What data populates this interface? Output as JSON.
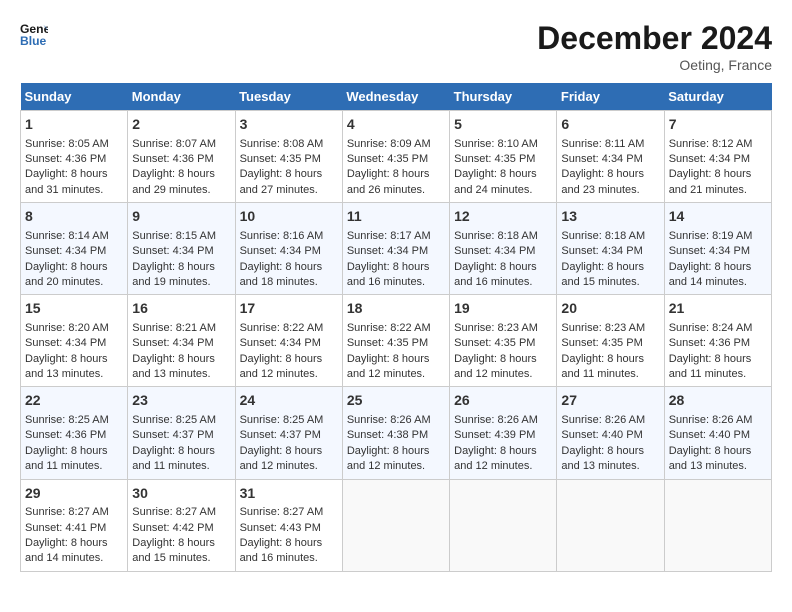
{
  "header": {
    "logo_line1": "General",
    "logo_line2": "Blue",
    "month": "December 2024",
    "location": "Oeting, France"
  },
  "weekdays": [
    "Sunday",
    "Monday",
    "Tuesday",
    "Wednesday",
    "Thursday",
    "Friday",
    "Saturday"
  ],
  "weeks": [
    [
      {
        "day": "1",
        "sunrise": "8:05 AM",
        "sunset": "4:36 PM",
        "daylight": "8 hours and 31 minutes."
      },
      {
        "day": "2",
        "sunrise": "8:07 AM",
        "sunset": "4:36 PM",
        "daylight": "8 hours and 29 minutes."
      },
      {
        "day": "3",
        "sunrise": "8:08 AM",
        "sunset": "4:35 PM",
        "daylight": "8 hours and 27 minutes."
      },
      {
        "day": "4",
        "sunrise": "8:09 AM",
        "sunset": "4:35 PM",
        "daylight": "8 hours and 26 minutes."
      },
      {
        "day": "5",
        "sunrise": "8:10 AM",
        "sunset": "4:35 PM",
        "daylight": "8 hours and 24 minutes."
      },
      {
        "day": "6",
        "sunrise": "8:11 AM",
        "sunset": "4:34 PM",
        "daylight": "8 hours and 23 minutes."
      },
      {
        "day": "7",
        "sunrise": "8:12 AM",
        "sunset": "4:34 PM",
        "daylight": "8 hours and 21 minutes."
      }
    ],
    [
      {
        "day": "8",
        "sunrise": "8:14 AM",
        "sunset": "4:34 PM",
        "daylight": "8 hours and 20 minutes."
      },
      {
        "day": "9",
        "sunrise": "8:15 AM",
        "sunset": "4:34 PM",
        "daylight": "8 hours and 19 minutes."
      },
      {
        "day": "10",
        "sunrise": "8:16 AM",
        "sunset": "4:34 PM",
        "daylight": "8 hours and 18 minutes."
      },
      {
        "day": "11",
        "sunrise": "8:17 AM",
        "sunset": "4:34 PM",
        "daylight": "8 hours and 16 minutes."
      },
      {
        "day": "12",
        "sunrise": "8:18 AM",
        "sunset": "4:34 PM",
        "daylight": "8 hours and 16 minutes."
      },
      {
        "day": "13",
        "sunrise": "8:18 AM",
        "sunset": "4:34 PM",
        "daylight": "8 hours and 15 minutes."
      },
      {
        "day": "14",
        "sunrise": "8:19 AM",
        "sunset": "4:34 PM",
        "daylight": "8 hours and 14 minutes."
      }
    ],
    [
      {
        "day": "15",
        "sunrise": "8:20 AM",
        "sunset": "4:34 PM",
        "daylight": "8 hours and 13 minutes."
      },
      {
        "day": "16",
        "sunrise": "8:21 AM",
        "sunset": "4:34 PM",
        "daylight": "8 hours and 13 minutes."
      },
      {
        "day": "17",
        "sunrise": "8:22 AM",
        "sunset": "4:34 PM",
        "daylight": "8 hours and 12 minutes."
      },
      {
        "day": "18",
        "sunrise": "8:22 AM",
        "sunset": "4:35 PM",
        "daylight": "8 hours and 12 minutes."
      },
      {
        "day": "19",
        "sunrise": "8:23 AM",
        "sunset": "4:35 PM",
        "daylight": "8 hours and 12 minutes."
      },
      {
        "day": "20",
        "sunrise": "8:23 AM",
        "sunset": "4:35 PM",
        "daylight": "8 hours and 11 minutes."
      },
      {
        "day": "21",
        "sunrise": "8:24 AM",
        "sunset": "4:36 PM",
        "daylight": "8 hours and 11 minutes."
      }
    ],
    [
      {
        "day": "22",
        "sunrise": "8:25 AM",
        "sunset": "4:36 PM",
        "daylight": "8 hours and 11 minutes."
      },
      {
        "day": "23",
        "sunrise": "8:25 AM",
        "sunset": "4:37 PM",
        "daylight": "8 hours and 11 minutes."
      },
      {
        "day": "24",
        "sunrise": "8:25 AM",
        "sunset": "4:37 PM",
        "daylight": "8 hours and 12 minutes."
      },
      {
        "day": "25",
        "sunrise": "8:26 AM",
        "sunset": "4:38 PM",
        "daylight": "8 hours and 12 minutes."
      },
      {
        "day": "26",
        "sunrise": "8:26 AM",
        "sunset": "4:39 PM",
        "daylight": "8 hours and 12 minutes."
      },
      {
        "day": "27",
        "sunrise": "8:26 AM",
        "sunset": "4:40 PM",
        "daylight": "8 hours and 13 minutes."
      },
      {
        "day": "28",
        "sunrise": "8:26 AM",
        "sunset": "4:40 PM",
        "daylight": "8 hours and 13 minutes."
      }
    ],
    [
      {
        "day": "29",
        "sunrise": "8:27 AM",
        "sunset": "4:41 PM",
        "daylight": "8 hours and 14 minutes."
      },
      {
        "day": "30",
        "sunrise": "8:27 AM",
        "sunset": "4:42 PM",
        "daylight": "8 hours and 15 minutes."
      },
      {
        "day": "31",
        "sunrise": "8:27 AM",
        "sunset": "4:43 PM",
        "daylight": "8 hours and 16 minutes."
      },
      null,
      null,
      null,
      null
    ]
  ]
}
